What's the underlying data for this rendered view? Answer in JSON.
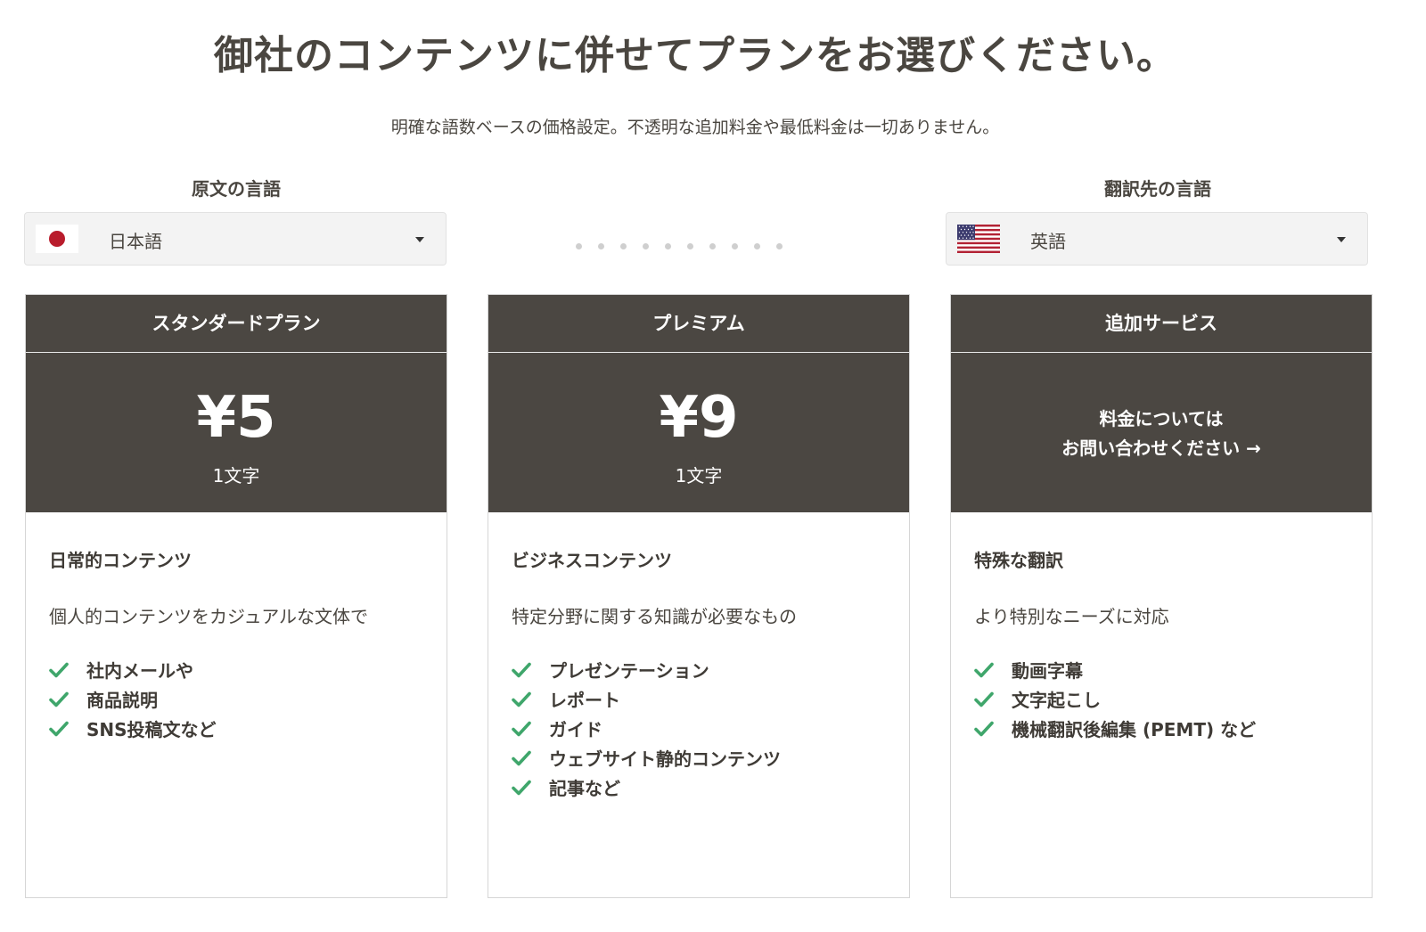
{
  "heading": {
    "title": "御社のコンテンツに併せてプランをお選びください。",
    "subtitle": "明確な語数ベースの価格設定。不透明な追加料金や最低料金は一切ありません。"
  },
  "source": {
    "label": "原文の言語",
    "value": "日本語",
    "flag_icon": "japan-flag-icon"
  },
  "target": {
    "label": "翻訳先の言語",
    "value": "英語",
    "flag_icon": "usa-flag-icon"
  },
  "colors": {
    "header_bg": "#4b4742",
    "check": "#3fa66b",
    "text": "#4a4640"
  },
  "plans": [
    {
      "name": "スタンダードプラン",
      "price": "¥5",
      "unit": "1文字",
      "title": "日常的コンテンツ",
      "description": "個人的コンテンツをカジュアルな文体で",
      "features": [
        "社内メールや",
        "商品説明",
        "SNS投稿文など"
      ]
    },
    {
      "name": "プレミアム",
      "price": "¥9",
      "unit": "1文字",
      "title": "ビジネスコンテンツ",
      "description": "特定分野に関する知識が必要なもの",
      "features": [
        "プレゼンテーション",
        "レポート",
        "ガイド",
        "ウェブサイト静的コンテンツ",
        "記事など"
      ]
    },
    {
      "name": "追加サービス",
      "contact_line1": "料金については",
      "contact_line2": "お問い合わせください →",
      "title": "特殊な翻訳",
      "description": "より特別なニーズに対応",
      "features": [
        "動画字幕",
        "文字起こし",
        "機械翻訳後編集 (PEMT) など"
      ]
    }
  ]
}
